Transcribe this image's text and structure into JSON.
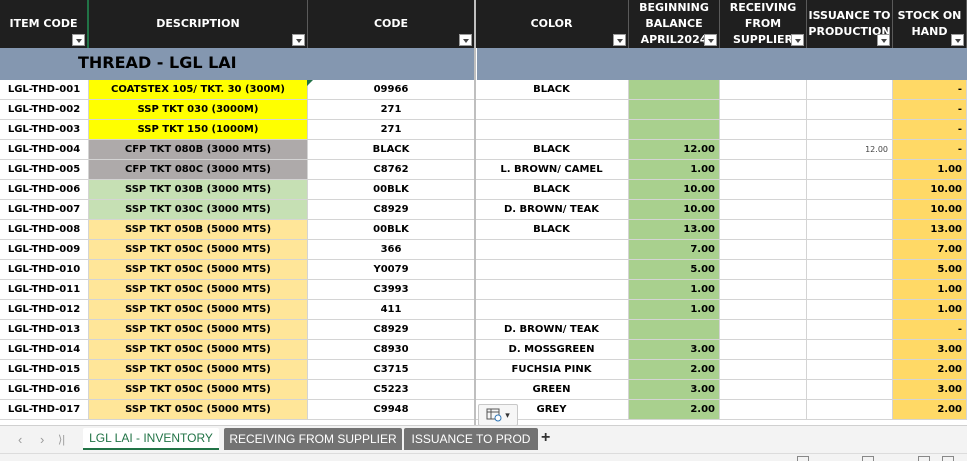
{
  "headers": [
    {
      "label": "ITEM CODE",
      "name": "header-item-code"
    },
    {
      "label": "DESCRIPTION",
      "name": "header-description"
    },
    {
      "label": "CODE",
      "name": "header-code"
    },
    {
      "label": "COLOR",
      "name": "header-color"
    },
    {
      "label": "BEGINNING\nBALANCE\nAPRIL2024",
      "name": "header-beginning-balance"
    },
    {
      "label": "RECEIVING\nFROM SUPPLIER",
      "name": "header-receiving"
    },
    {
      "label": "ISSUANCE TO\nPRODUCTION",
      "name": "header-issuance"
    },
    {
      "label": "STOCK ON\nHAND",
      "name": "header-stock-on-hand"
    }
  ],
  "section_title": "THREAD - LGL LAI",
  "rows": [
    {
      "item_code": "LGL-THD-001",
      "description": "COATSTEX 105/ TKT. 30 (300M)",
      "code": "09966",
      "color": "BLACK",
      "beginning": "",
      "receiving": "",
      "issuance": "",
      "stock": "-",
      "desc_bg": "#ffff00"
    },
    {
      "item_code": "LGL-THD-002",
      "description": "SSP TKT 030 (3000M)",
      "code": "271",
      "color": "",
      "beginning": "",
      "receiving": "",
      "issuance": "",
      "stock": "-",
      "desc_bg": "#ffff00"
    },
    {
      "item_code": "LGL-THD-003",
      "description": "SSP TKT 150 (1000M)",
      "code": "271",
      "color": "",
      "beginning": "",
      "receiving": "",
      "issuance": "",
      "stock": "-",
      "desc_bg": "#ffff00"
    },
    {
      "item_code": "LGL-THD-004",
      "description": "CFP TKT 080B (3000 MTS)",
      "code": "BLACK",
      "color": "BLACK",
      "beginning": "12.00",
      "receiving": "",
      "issuance": "12.00",
      "stock": "-",
      "desc_bg": "#aeaaaa"
    },
    {
      "item_code": "LGL-THD-005",
      "description": "CFP TKT 080C (3000 MTS)",
      "code": "C8762",
      "color": "L. BROWN/ CAMEL",
      "beginning": "1.00",
      "receiving": "",
      "issuance": "",
      "stock": "1.00",
      "desc_bg": "#aeaaaa"
    },
    {
      "item_code": "LGL-THD-006",
      "description": "SSP TKT 030B (3000 MTS)",
      "code": "00BLK",
      "color": "BLACK",
      "beginning": "10.00",
      "receiving": "",
      "issuance": "",
      "stock": "10.00",
      "desc_bg": "#c6e0b4"
    },
    {
      "item_code": "LGL-THD-007",
      "description": "SSP TKT 030C (3000 MTS)",
      "code": "C8929",
      "color": "D. BROWN/ TEAK",
      "beginning": "10.00",
      "receiving": "",
      "issuance": "",
      "stock": "10.00",
      "desc_bg": "#c6e0b4"
    },
    {
      "item_code": "LGL-THD-008",
      "description": "SSP TKT 050B (5000 MTS)",
      "code": "00BLK",
      "color": "BLACK",
      "beginning": "13.00",
      "receiving": "",
      "issuance": "",
      "stock": "13.00",
      "desc_bg": "#ffe699"
    },
    {
      "item_code": "LGL-THD-009",
      "description": "SSP TKT 050C (5000 MTS)",
      "code": "366",
      "color": "",
      "beginning": "7.00",
      "receiving": "",
      "issuance": "",
      "stock": "7.00",
      "desc_bg": "#ffe699"
    },
    {
      "item_code": "LGL-THD-010",
      "description": "SSP TKT 050C (5000 MTS)",
      "code": "Y0079",
      "color": "",
      "beginning": "5.00",
      "receiving": "",
      "issuance": "",
      "stock": "5.00",
      "desc_bg": "#ffe699"
    },
    {
      "item_code": "LGL-THD-011",
      "description": "SSP TKT 050C (5000 MTS)",
      "code": "C3993",
      "color": "",
      "beginning": "1.00",
      "receiving": "",
      "issuance": "",
      "stock": "1.00",
      "desc_bg": "#ffe699"
    },
    {
      "item_code": "LGL-THD-012",
      "description": "SSP TKT 050C (5000 MTS)",
      "code": "411",
      "color": "",
      "beginning": "1.00",
      "receiving": "",
      "issuance": "",
      "stock": "1.00",
      "desc_bg": "#ffe699"
    },
    {
      "item_code": "LGL-THD-013",
      "description": "SSP TKT 050C (5000 MTS)",
      "code": "C8929",
      "color": "D. BROWN/ TEAK",
      "beginning": "",
      "receiving": "",
      "issuance": "",
      "stock": "-",
      "desc_bg": "#ffe699"
    },
    {
      "item_code": "LGL-THD-014",
      "description": "SSP TKT 050C (5000 MTS)",
      "code": "C8930",
      "color": "D. MOSSGREEN",
      "beginning": "3.00",
      "receiving": "",
      "issuance": "",
      "stock": "3.00",
      "desc_bg": "#ffe699"
    },
    {
      "item_code": "LGL-THD-015",
      "description": "SSP TKT 050C (5000 MTS)",
      "code": "C3715",
      "color": "FUCHSIA PINK",
      "beginning": "2.00",
      "receiving": "",
      "issuance": "",
      "stock": "2.00",
      "desc_bg": "#ffe699"
    },
    {
      "item_code": "LGL-THD-016",
      "description": "SSP TKT 050C (5000 MTS)",
      "code": "C5223",
      "color": "GREEN",
      "beginning": "3.00",
      "receiving": "",
      "issuance": "",
      "stock": "3.00",
      "desc_bg": "#ffe699"
    },
    {
      "item_code": "LGL-THD-017",
      "description": "SSP TKT 050C (5000 MTS)",
      "code": "C9948",
      "color": "GREY",
      "beginning": "2.00",
      "receiving": "",
      "issuance": "",
      "stock": "2.00",
      "desc_bg": "#ffe699"
    }
  ],
  "colors": {
    "beginning_bg": "#a9d08e",
    "stock_bg": "#ffd966",
    "header_bg": "#1f1f1f",
    "section_band": "#8497b0",
    "excel_green": "#217346"
  },
  "tabs": [
    {
      "label": "LGL LAI - INVENTORY",
      "active": true
    },
    {
      "label": "RECEIVING FROM SUPPLIER",
      "active": false
    },
    {
      "label": "ISSUANCE TO PROD",
      "active": false
    }
  ],
  "tab_nav": {
    "prev": "‹",
    "next": "›",
    "last": "⟩|"
  },
  "add_sheet_label": "+",
  "quick_analysis_icon": "quick-analysis-icon"
}
